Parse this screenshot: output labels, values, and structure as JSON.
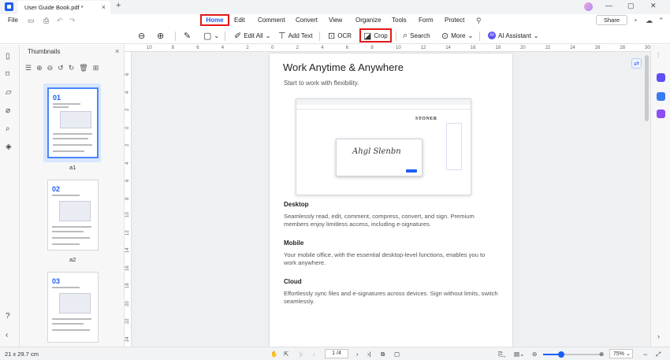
{
  "titlebar": {
    "tab_title": "User Guide Book.pdf *",
    "new_tab": "+",
    "close_tab": "×",
    "minimize": "—",
    "restore": "▢",
    "close": "✕"
  },
  "menu": {
    "file": "File",
    "items": [
      "Home",
      "Edit",
      "Comment",
      "Convert",
      "View",
      "Organize",
      "Tools",
      "Form",
      "Protect"
    ],
    "share": "Share"
  },
  "toolbar": {
    "edit_all": "Edit All",
    "add_text": "Add Text",
    "ocr": "OCR",
    "crop": "Crop",
    "search": "Search",
    "more": "More",
    "ai_assistant": "AI Assistant"
  },
  "thumbnails": {
    "title": "Thumbnails",
    "pages": [
      {
        "num": "01",
        "label": "a1",
        "selected": true
      },
      {
        "num": "02",
        "label": "a2",
        "selected": false
      },
      {
        "num": "03",
        "label": "",
        "selected": false
      }
    ]
  },
  "ruler": {
    "top": [
      "10",
      "8",
      "6",
      "4",
      "2",
      "0",
      "2",
      "4",
      "6",
      "8",
      "10",
      "12",
      "14",
      "16",
      "18",
      "20",
      "22",
      "24",
      "26",
      "28",
      "30"
    ],
    "left": [
      "6",
      "4",
      "2",
      "0",
      "2",
      "4",
      "6",
      "8",
      "10",
      "12",
      "14",
      "16",
      "18",
      "20",
      "22",
      "24",
      "26"
    ]
  },
  "page": {
    "title": "Work Anytime & Anywhere",
    "subtitle": "Start to work with flexibility.",
    "mini_brand": "STONER",
    "sections": [
      {
        "heading": "Desktop",
        "text": "Seamlessly read, edit, comment, compress, convert, and sign. Premium members enjoy limitless access, including e-signatures."
      },
      {
        "heading": "Mobile",
        "text": "Your mobile office, with the essential desktop-level functions, enables you to work anywhere."
      },
      {
        "heading": "Cloud",
        "text": "Effortlessly sync files and e-signatures across devices. Sign without limits, switch seamlessly."
      }
    ]
  },
  "statusbar": {
    "page_size": "21 x 29.7 cm",
    "page_indicator": "1 /4",
    "zoom": "75%",
    "zoom_fraction": 0.3
  },
  "colors": {
    "accent": "#1d5ef5",
    "highlight_box": "#e31818"
  }
}
